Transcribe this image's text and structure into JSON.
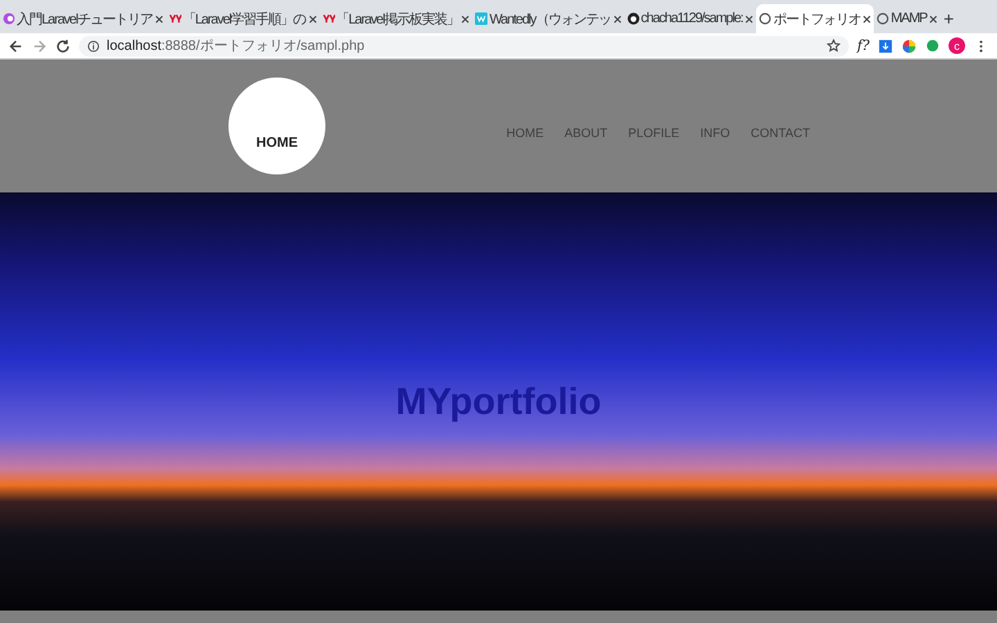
{
  "tabs": [
    {
      "title": "入門Laravelチュートリア",
      "selected": false
    },
    {
      "title": "「Laravel学習手順」の",
      "selected": false
    },
    {
      "title": "「Laravel掲示板実装」",
      "selected": false
    },
    {
      "title": "Wantedly（ウォンテッ",
      "selected": false
    },
    {
      "title": "chacha1129/sample:",
      "selected": false
    },
    {
      "title": "ポートフォリオ",
      "selected": true
    },
    {
      "title": "MAMP",
      "selected": false
    }
  ],
  "new_tab": "+",
  "address_bar": {
    "host": "localhost",
    "rest": ":8888/ポートフォリオ/sampl.php"
  },
  "extensions": {
    "font_ext": "f?",
    "avatar": "c"
  },
  "header": {
    "logo": "HOME",
    "nav": [
      "HOME",
      "ABOUT",
      "PLOFILE",
      "INFO",
      "CONTACT"
    ]
  },
  "hero": {
    "title": "MYportfolio"
  }
}
